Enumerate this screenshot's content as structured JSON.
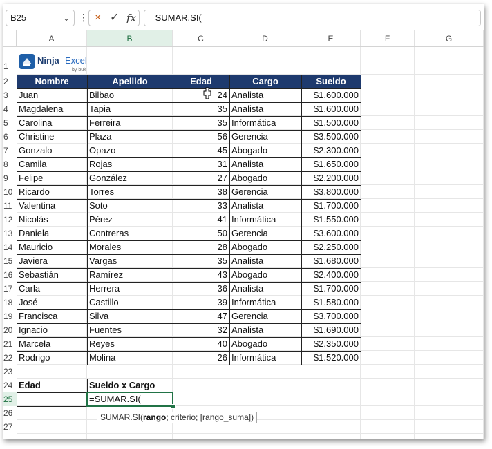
{
  "name_box": "B25",
  "formula_bar": "=SUMAR.SI(",
  "formula_icons": {
    "cancel": "×",
    "enter": "✓",
    "function": "fx"
  },
  "column_headers": [
    "A",
    "B",
    "C",
    "D",
    "E",
    "F",
    "G"
  ],
  "row_numbers": [
    "1",
    "2",
    "3",
    "4",
    "5",
    "6",
    "7",
    "8",
    "9",
    "10",
    "11",
    "12",
    "13",
    "14",
    "15",
    "16",
    "17",
    "18",
    "19",
    "20",
    "21",
    "22",
    "23",
    "24",
    "25",
    "26",
    "27"
  ],
  "logo": {
    "brand": "Ninja",
    "product": "Excel",
    "by": "by buk"
  },
  "table": {
    "headers": [
      "Nombre",
      "Apellido",
      "Edad",
      "Cargo",
      "Sueldo"
    ],
    "rows": [
      [
        "Juan",
        "Bilbao",
        "24",
        "Analista",
        "$1.600.000"
      ],
      [
        "Magdalena",
        "Tapia",
        "35",
        "Analista",
        "$1.600.000"
      ],
      [
        "Carolina",
        "Ferreira",
        "35",
        "Informática",
        "$1.500.000"
      ],
      [
        "Christine",
        "Plaza",
        "56",
        "Gerencia",
        "$3.500.000"
      ],
      [
        "Gonzalo",
        "Opazo",
        "45",
        "Abogado",
        "$2.300.000"
      ],
      [
        "Camila",
        "Rojas",
        "31",
        "Analista",
        "$1.650.000"
      ],
      [
        "Felipe",
        "González",
        "27",
        "Abogado",
        "$2.200.000"
      ],
      [
        "Ricardo",
        "Torres",
        "38",
        "Gerencia",
        "$3.800.000"
      ],
      [
        "Valentina",
        "Soto",
        "33",
        "Analista",
        "$1.700.000"
      ],
      [
        "Nicolás",
        "Pérez",
        "41",
        "Informática",
        "$1.550.000"
      ],
      [
        "Daniela",
        "Contreras",
        "50",
        "Gerencia",
        "$3.600.000"
      ],
      [
        "Mauricio",
        "Morales",
        "28",
        "Abogado",
        "$2.250.000"
      ],
      [
        "Javiera",
        "Vargas",
        "35",
        "Analista",
        "$1.680.000"
      ],
      [
        "Sebastián",
        "Ramírez",
        "43",
        "Abogado",
        "$2.400.000"
      ],
      [
        "Carla",
        "Herrera",
        "36",
        "Analista",
        "$1.700.000"
      ],
      [
        "José",
        "Castillo",
        "39",
        "Informática",
        "$1.580.000"
      ],
      [
        "Francisca",
        "Silva",
        "47",
        "Gerencia",
        "$3.700.000"
      ],
      [
        "Ignacio",
        "Fuentes",
        "32",
        "Analista",
        "$1.690.000"
      ],
      [
        "Marcela",
        "Reyes",
        "40",
        "Abogado",
        "$2.350.000"
      ],
      [
        "Rodrigo",
        "Molina",
        "26",
        "Informática",
        "$1.520.000"
      ]
    ]
  },
  "summary": {
    "label_a": "Edad",
    "label_b": "Sueldo x Cargo",
    "a25_value": "",
    "b25_value": "=SUMAR.SI("
  },
  "tooltip": {
    "func": "SUMAR.SI(",
    "arg1": "rango",
    "rest": "; criterio; [rango_suma])"
  },
  "colors": {
    "header_fill": "#1e3a6e",
    "selection": "#217346"
  }
}
